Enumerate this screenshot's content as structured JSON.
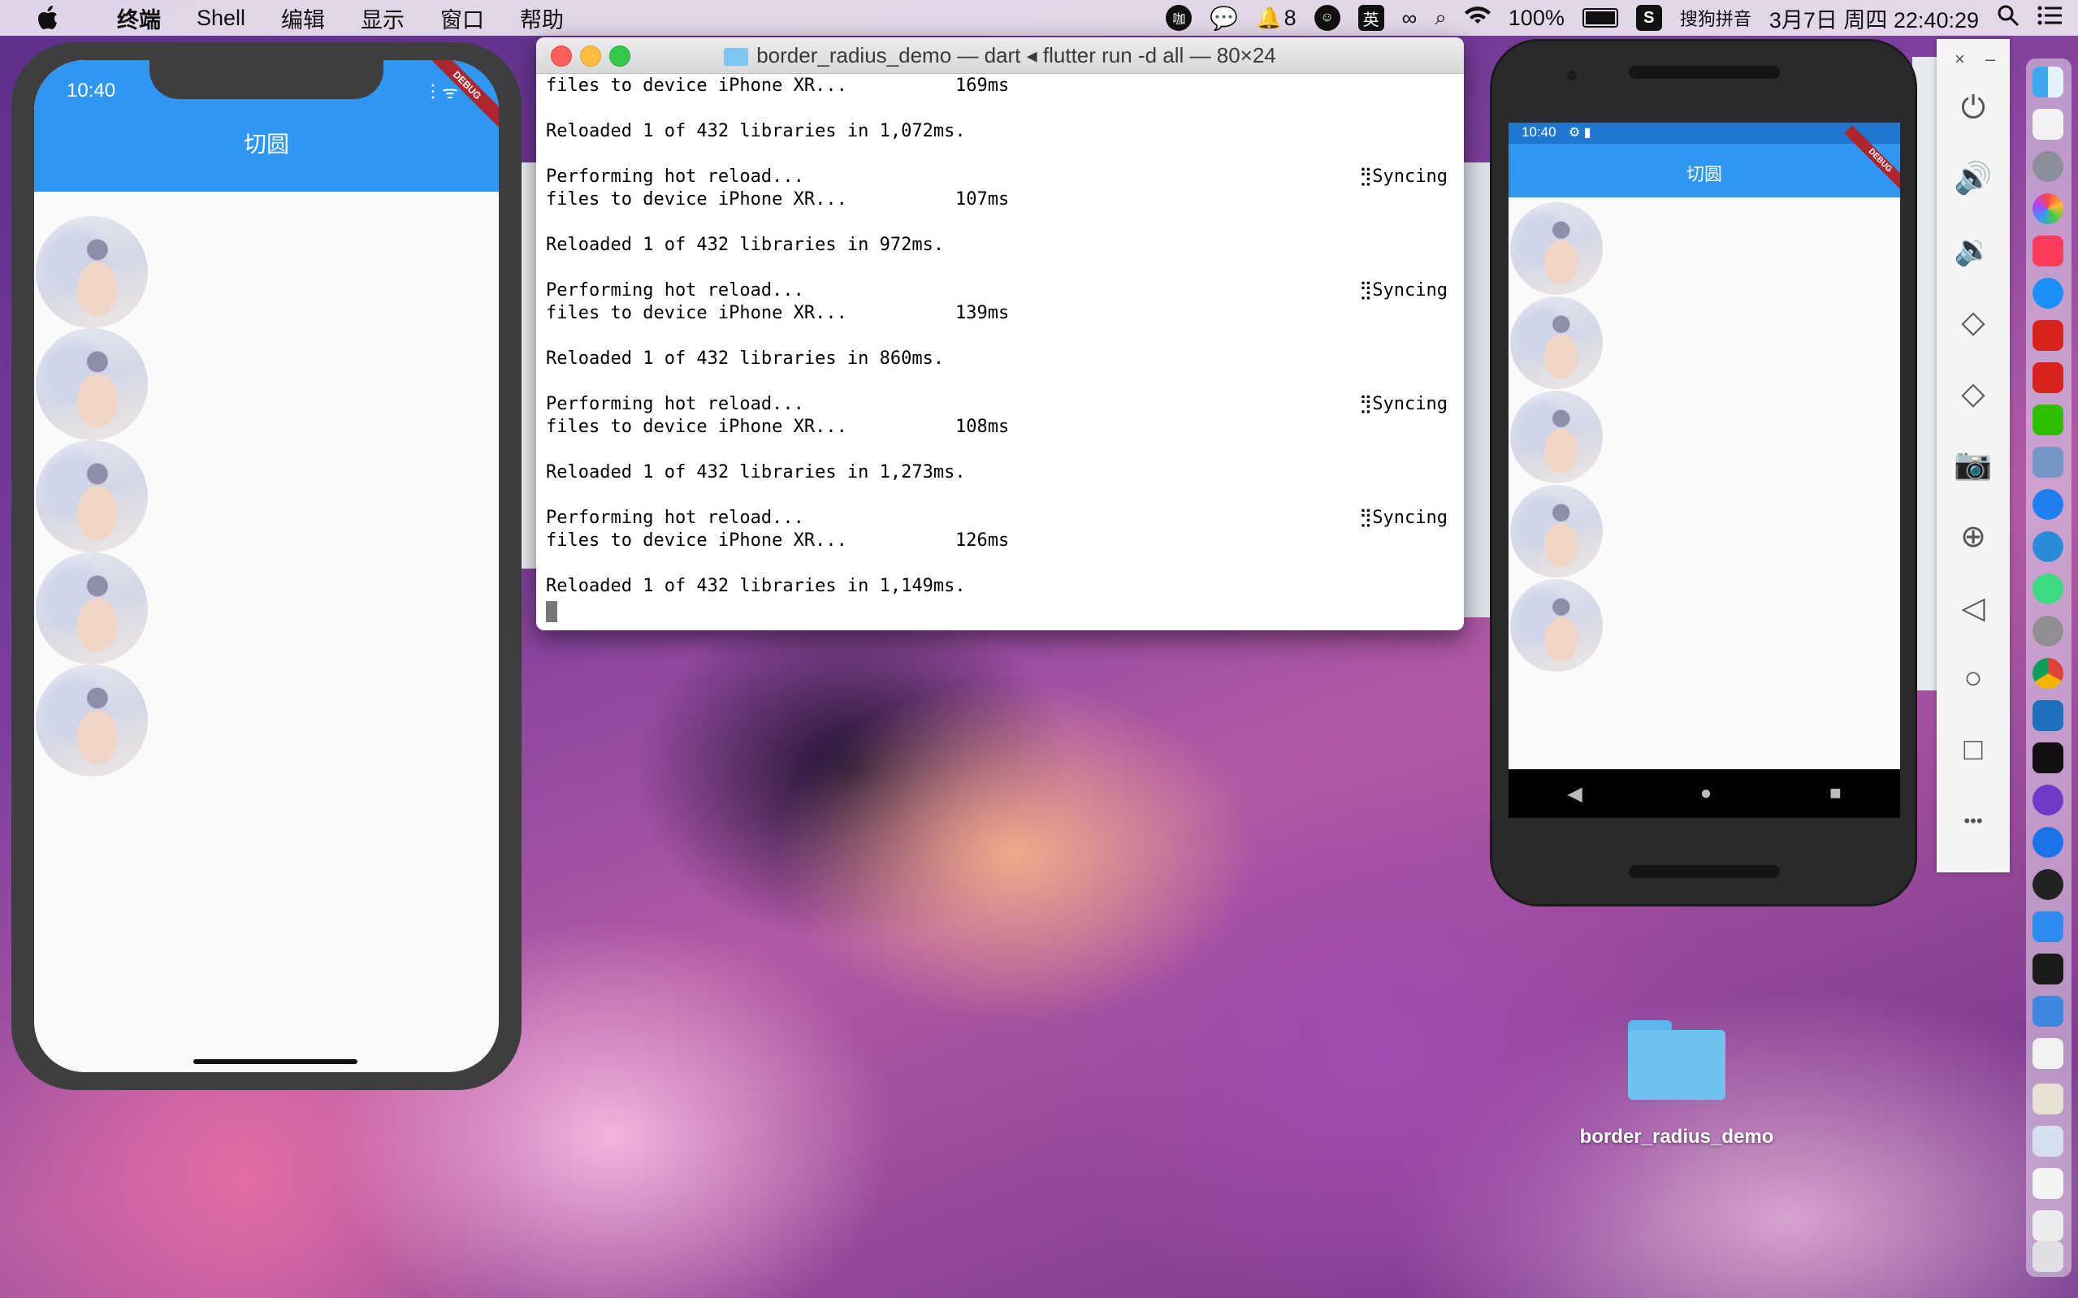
{
  "menubar": {
    "app_name": "终端",
    "items": [
      "Shell",
      "编辑",
      "显示",
      "窗口",
      "帮助"
    ],
    "notification_count": "8",
    "input_lang": "英",
    "battery": "100%",
    "ime_name": "搜狗拼音",
    "datetime": "3月7日 周四 22:40:29"
  },
  "iphone": {
    "time": "10:40",
    "title": "切圆",
    "debug_label": "DEBUG"
  },
  "terminal": {
    "title": "border_radius_demo — dart ◂ flutter run -d all — 80×24",
    "lines": [
      {
        "text": "files to device iPhone XR...",
        "ms": "169ms",
        "sync": ""
      },
      {
        "text": "",
        "ms": "",
        "sync": ""
      },
      {
        "text": "Reloaded 1 of 432 libraries in 1,072ms.",
        "ms": "",
        "sync": ""
      },
      {
        "text": "",
        "ms": "",
        "sync": ""
      },
      {
        "text": "Performing hot reload...",
        "ms": "",
        "sync": "⣻Syncing"
      },
      {
        "text": "files to device iPhone XR...",
        "ms": "107ms",
        "sync": ""
      },
      {
        "text": "",
        "ms": "",
        "sync": ""
      },
      {
        "text": "Reloaded 1 of 432 libraries in 972ms.",
        "ms": "",
        "sync": ""
      },
      {
        "text": "",
        "ms": "",
        "sync": ""
      },
      {
        "text": "Performing hot reload...",
        "ms": "",
        "sync": "⣻Syncing"
      },
      {
        "text": "files to device iPhone XR...",
        "ms": "139ms",
        "sync": ""
      },
      {
        "text": "",
        "ms": "",
        "sync": ""
      },
      {
        "text": "Reloaded 1 of 432 libraries in 860ms.",
        "ms": "",
        "sync": ""
      },
      {
        "text": "",
        "ms": "",
        "sync": ""
      },
      {
        "text": "Performing hot reload...",
        "ms": "",
        "sync": "⣻Syncing"
      },
      {
        "text": "files to device iPhone XR...",
        "ms": "108ms",
        "sync": ""
      },
      {
        "text": "",
        "ms": "",
        "sync": ""
      },
      {
        "text": "Reloaded 1 of 432 libraries in 1,273ms.",
        "ms": "",
        "sync": ""
      },
      {
        "text": "",
        "ms": "",
        "sync": ""
      },
      {
        "text": "Performing hot reload...",
        "ms": "",
        "sync": "⣻Syncing"
      },
      {
        "text": "files to device iPhone XR...",
        "ms": "126ms",
        "sync": ""
      },
      {
        "text": "",
        "ms": "",
        "sync": ""
      },
      {
        "text": "Reloaded 1 of 432 libraries in 1,149ms.",
        "ms": "",
        "sync": ""
      }
    ]
  },
  "android": {
    "time": "10:40",
    "title": "切圆",
    "debug_label": "DEBUG"
  },
  "emulator_tools": {
    "close": "×",
    "minimize": "–",
    "more": "•••"
  },
  "desktop": {
    "folder_label": "border_radius_demo"
  }
}
